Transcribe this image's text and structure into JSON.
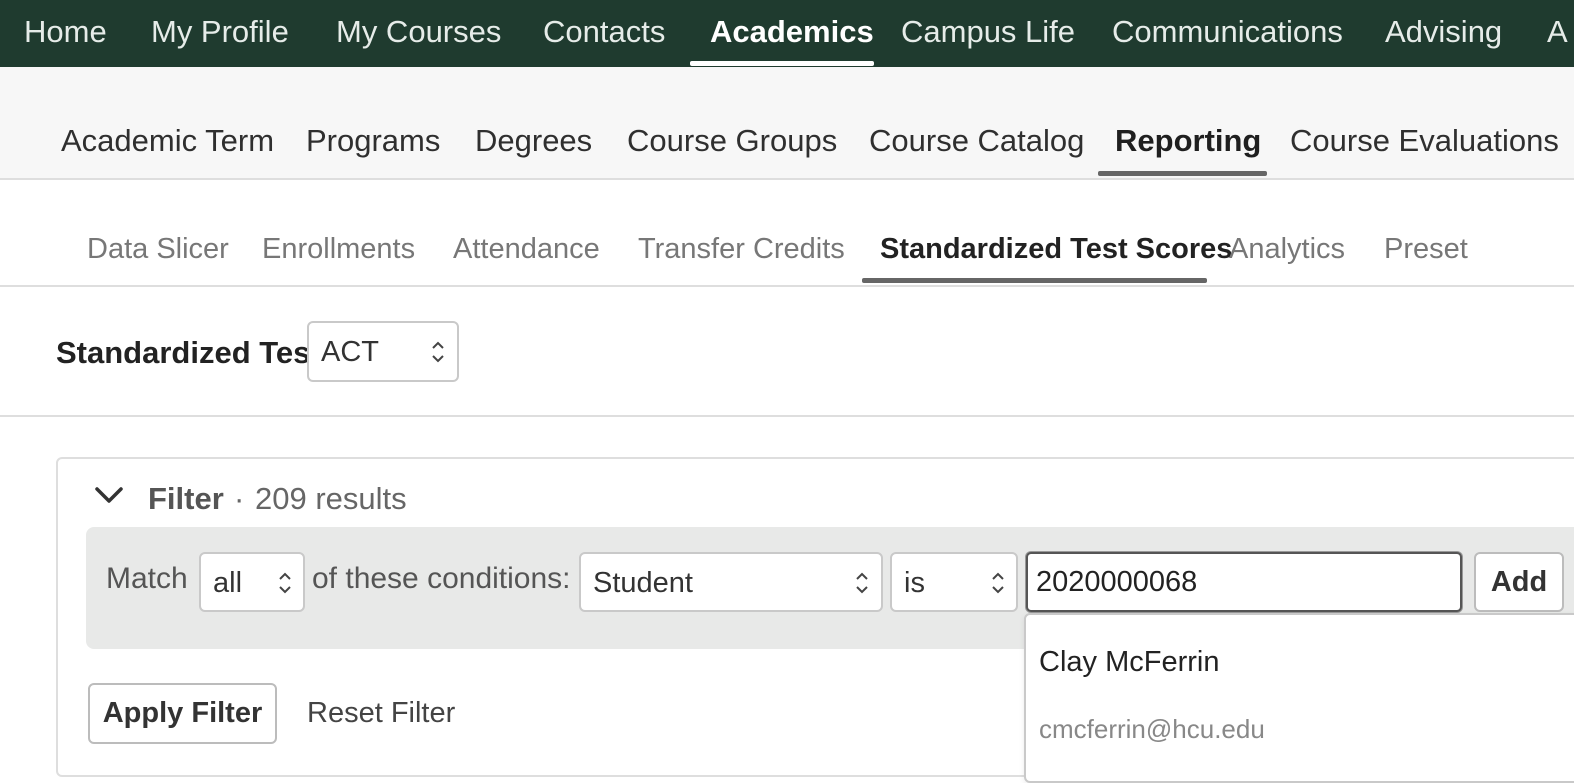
{
  "top_nav": {
    "items": [
      "Home",
      "My Profile",
      "My Courses",
      "Contacts",
      "Academics",
      "Campus Life",
      "Communications",
      "Advising",
      "A"
    ],
    "active": "Academics"
  },
  "sub_nav": {
    "items": [
      "Academic Term",
      "Programs",
      "Degrees",
      "Course Groups",
      "Course Catalog",
      "Reporting",
      "Course Evaluations"
    ],
    "active": "Reporting"
  },
  "report_tabs": {
    "items": [
      "Data Slicer",
      "Enrollments",
      "Attendance",
      "Transfer Credits",
      "Standardized Test Scores",
      "Analytics",
      "Preset"
    ],
    "active": "Standardized Test Scores"
  },
  "standardized_test": {
    "label": "Standardized Test",
    "selected": "ACT"
  },
  "filter": {
    "title": "Filter",
    "separator": "·",
    "result_count": "209 results",
    "match_label": "Match",
    "match_value": "all",
    "conditions_label": "of these conditions:",
    "field_value": "Student",
    "operator_value": "is",
    "input_value": "2020000068",
    "add_label": "Add",
    "apply_label": "Apply Filter",
    "reset_label": "Reset Filter"
  },
  "autocomplete": {
    "name": "Clay McFerrin",
    "email": "cmcferrin@hcu.edu"
  },
  "icons": [
    "chevron-down-icon",
    "select-arrows-icon"
  ],
  "colors": {
    "nav_background": "#1f3b2f",
    "panel_background": "#e8e9e8"
  }
}
